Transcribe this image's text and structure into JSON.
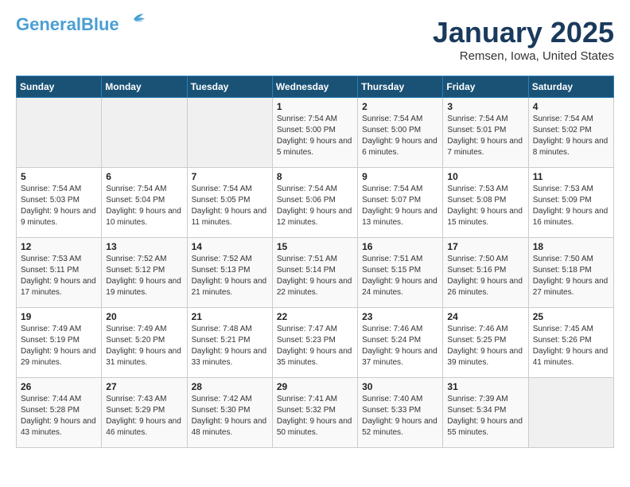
{
  "header": {
    "logo_line1": "General",
    "logo_line2": "Blue",
    "month_title": "January 2025",
    "location": "Remsen, Iowa, United States"
  },
  "days_of_week": [
    "Sunday",
    "Monday",
    "Tuesday",
    "Wednesday",
    "Thursday",
    "Friday",
    "Saturday"
  ],
  "weeks": [
    [
      {
        "day": "",
        "empty": true
      },
      {
        "day": "",
        "empty": true
      },
      {
        "day": "",
        "empty": true
      },
      {
        "day": "1",
        "sunrise": "7:54 AM",
        "sunset": "5:00 PM",
        "daylight": "9 hours and 5 minutes."
      },
      {
        "day": "2",
        "sunrise": "7:54 AM",
        "sunset": "5:00 PM",
        "daylight": "9 hours and 6 minutes."
      },
      {
        "day": "3",
        "sunrise": "7:54 AM",
        "sunset": "5:01 PM",
        "daylight": "9 hours and 7 minutes."
      },
      {
        "day": "4",
        "sunrise": "7:54 AM",
        "sunset": "5:02 PM",
        "daylight": "9 hours and 8 minutes."
      }
    ],
    [
      {
        "day": "5",
        "sunrise": "7:54 AM",
        "sunset": "5:03 PM",
        "daylight": "9 hours and 9 minutes."
      },
      {
        "day": "6",
        "sunrise": "7:54 AM",
        "sunset": "5:04 PM",
        "daylight": "9 hours and 10 minutes."
      },
      {
        "day": "7",
        "sunrise": "7:54 AM",
        "sunset": "5:05 PM",
        "daylight": "9 hours and 11 minutes."
      },
      {
        "day": "8",
        "sunrise": "7:54 AM",
        "sunset": "5:06 PM",
        "daylight": "9 hours and 12 minutes."
      },
      {
        "day": "9",
        "sunrise": "7:54 AM",
        "sunset": "5:07 PM",
        "daylight": "9 hours and 13 minutes."
      },
      {
        "day": "10",
        "sunrise": "7:53 AM",
        "sunset": "5:08 PM",
        "daylight": "9 hours and 15 minutes."
      },
      {
        "day": "11",
        "sunrise": "7:53 AM",
        "sunset": "5:09 PM",
        "daylight": "9 hours and 16 minutes."
      }
    ],
    [
      {
        "day": "12",
        "sunrise": "7:53 AM",
        "sunset": "5:11 PM",
        "daylight": "9 hours and 17 minutes."
      },
      {
        "day": "13",
        "sunrise": "7:52 AM",
        "sunset": "5:12 PM",
        "daylight": "9 hours and 19 minutes."
      },
      {
        "day": "14",
        "sunrise": "7:52 AM",
        "sunset": "5:13 PM",
        "daylight": "9 hours and 21 minutes."
      },
      {
        "day": "15",
        "sunrise": "7:51 AM",
        "sunset": "5:14 PM",
        "daylight": "9 hours and 22 minutes."
      },
      {
        "day": "16",
        "sunrise": "7:51 AM",
        "sunset": "5:15 PM",
        "daylight": "9 hours and 24 minutes."
      },
      {
        "day": "17",
        "sunrise": "7:50 AM",
        "sunset": "5:16 PM",
        "daylight": "9 hours and 26 minutes."
      },
      {
        "day": "18",
        "sunrise": "7:50 AM",
        "sunset": "5:18 PM",
        "daylight": "9 hours and 27 minutes."
      }
    ],
    [
      {
        "day": "19",
        "sunrise": "7:49 AM",
        "sunset": "5:19 PM",
        "daylight": "9 hours and 29 minutes."
      },
      {
        "day": "20",
        "sunrise": "7:49 AM",
        "sunset": "5:20 PM",
        "daylight": "9 hours and 31 minutes."
      },
      {
        "day": "21",
        "sunrise": "7:48 AM",
        "sunset": "5:21 PM",
        "daylight": "9 hours and 33 minutes."
      },
      {
        "day": "22",
        "sunrise": "7:47 AM",
        "sunset": "5:23 PM",
        "daylight": "9 hours and 35 minutes."
      },
      {
        "day": "23",
        "sunrise": "7:46 AM",
        "sunset": "5:24 PM",
        "daylight": "9 hours and 37 minutes."
      },
      {
        "day": "24",
        "sunrise": "7:46 AM",
        "sunset": "5:25 PM",
        "daylight": "9 hours and 39 minutes."
      },
      {
        "day": "25",
        "sunrise": "7:45 AM",
        "sunset": "5:26 PM",
        "daylight": "9 hours and 41 minutes."
      }
    ],
    [
      {
        "day": "26",
        "sunrise": "7:44 AM",
        "sunset": "5:28 PM",
        "daylight": "9 hours and 43 minutes."
      },
      {
        "day": "27",
        "sunrise": "7:43 AM",
        "sunset": "5:29 PM",
        "daylight": "9 hours and 46 minutes."
      },
      {
        "day": "28",
        "sunrise": "7:42 AM",
        "sunset": "5:30 PM",
        "daylight": "9 hours and 48 minutes."
      },
      {
        "day": "29",
        "sunrise": "7:41 AM",
        "sunset": "5:32 PM",
        "daylight": "9 hours and 50 minutes."
      },
      {
        "day": "30",
        "sunrise": "7:40 AM",
        "sunset": "5:33 PM",
        "daylight": "9 hours and 52 minutes."
      },
      {
        "day": "31",
        "sunrise": "7:39 AM",
        "sunset": "5:34 PM",
        "daylight": "9 hours and 55 minutes."
      },
      {
        "day": "",
        "empty": true
      }
    ]
  ]
}
